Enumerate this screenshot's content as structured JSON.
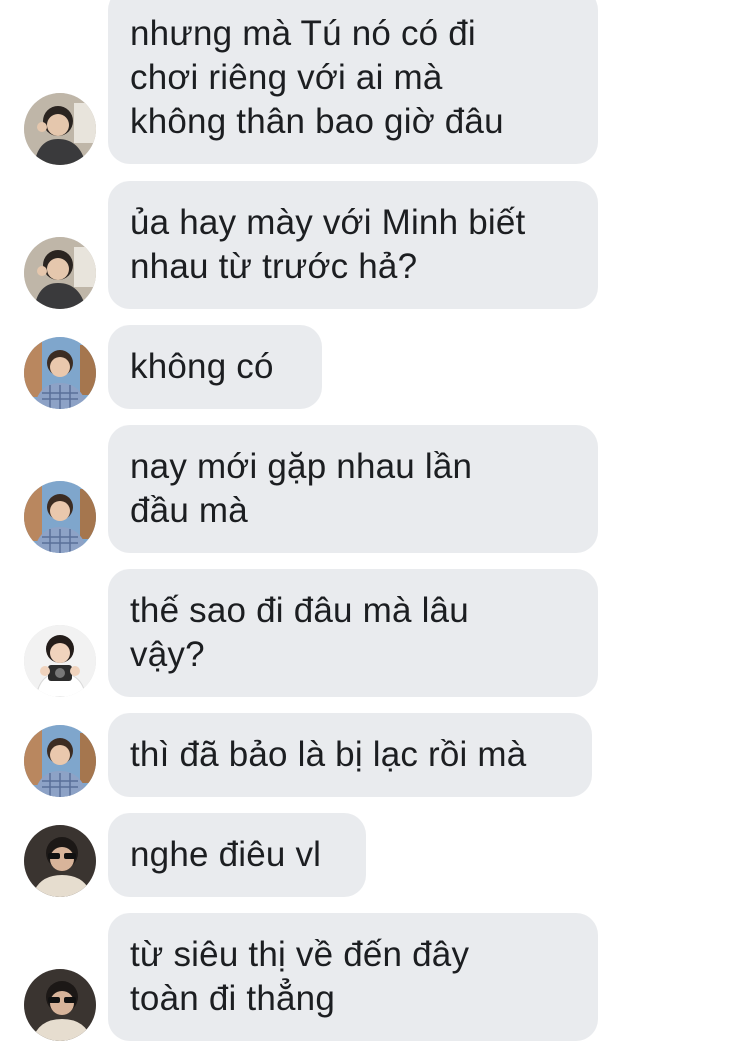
{
  "messages": [
    {
      "text": "nhưng mà Tú nó có đi\nchơi riêng với ai mà\nkhông thân bao giờ đâu",
      "avatar": "avatar-a"
    },
    {
      "text": "ủa hay mày với Minh biết\nnhau từ trước hả?",
      "avatar": "avatar-a"
    },
    {
      "text": "không có",
      "avatar": "avatar-b"
    },
    {
      "text": "nay mới gặp nhau lần\nđầu mà",
      "avatar": "avatar-b"
    },
    {
      "text": "thế sao đi đâu mà lâu\nvậy?",
      "avatar": "avatar-c"
    },
    {
      "text": "thì đã bảo là bị lạc rồi mà",
      "avatar": "avatar-b"
    },
    {
      "text": "nghe điêu vl",
      "avatar": "avatar-d"
    },
    {
      "text": "từ siêu thị về đến đây\ntoàn đi thẳng",
      "avatar": "avatar-d"
    }
  ],
  "colors": {
    "bubble_bg": "#e9ebee",
    "text": "#1c1e21",
    "background": "#ffffff"
  }
}
